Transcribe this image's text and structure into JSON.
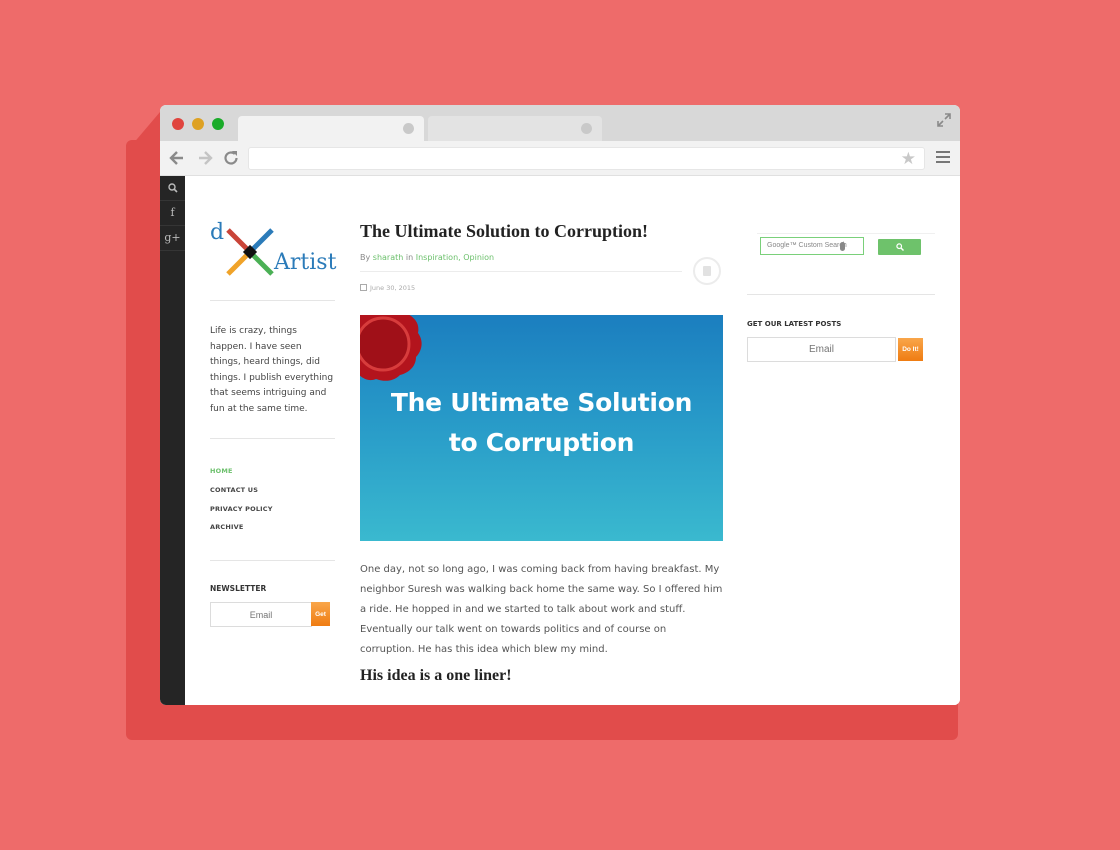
{
  "colors": {
    "background": "#ee6b6a",
    "accent_green": "#6cc06c",
    "button_orange": "#ef7c12",
    "hero_blue": "#1b7ebf",
    "hero_cyan": "#3ab9cf",
    "logo_blue": "#2b7bb9",
    "social_bar": "#252525"
  },
  "browser": {
    "window_controls": [
      "close",
      "minimize",
      "zoom"
    ],
    "tabs": [
      "",
      ""
    ],
    "address": "",
    "icons": [
      "back-arrow-icon",
      "forward-arrow-icon",
      "reload-icon",
      "star-icon",
      "menu-icon",
      "expand-icon"
    ]
  },
  "social": {
    "items": [
      {
        "name": "search",
        "icon": "search-icon"
      },
      {
        "name": "facebook",
        "label": "f",
        "icon": "facebook-icon"
      },
      {
        "name": "google-plus",
        "label": "g+",
        "icon": "google-plus-icon"
      }
    ]
  },
  "sidebar": {
    "logo": {
      "letter": "d",
      "word": "Artist"
    },
    "about": "Life is crazy, things happen. I have seen things, heard things, did things. I publish everything that seems intriguing and fun at the same time.",
    "menu": [
      {
        "label": "HOME",
        "active": true
      },
      {
        "label": "CONTACT US",
        "active": false
      },
      {
        "label": "PRIVACY POLICY",
        "active": false
      },
      {
        "label": "ARCHIVE",
        "active": false
      }
    ],
    "newsletter": {
      "title": "NEWSLETTER",
      "placeholder": "Email",
      "button": "Get"
    }
  },
  "post": {
    "title": "The Ultimate Solution to Corruption!",
    "byline": {
      "by": "By",
      "author": "sharath",
      "in": "in",
      "category_1": "Inspiration",
      "separator": ",",
      "category_2": "Opinion"
    },
    "date": "June 30, 2015",
    "hero_image": {
      "line_1": "The Ultimate Solution",
      "line_2": "to Corruption"
    },
    "body": [
      "One day, not so long ago, I was coming back from having breakfast. My neighbor Suresh was walking back home the same way. So I offered him a ride. He hopped in and we started to talk about work and stuff.",
      "Eventually our talk went on towards politics and of course on corruption. He has this idea which blew my mind."
    ],
    "subheading": "His idea is a one liner!"
  },
  "right_sidebar": {
    "search": {
      "google_label": "Google",
      "custom_label": "Custom Search"
    },
    "latest_posts": {
      "title": "GET OUR LATEST POSTS",
      "placeholder": "Email",
      "button": "Do It!"
    }
  }
}
